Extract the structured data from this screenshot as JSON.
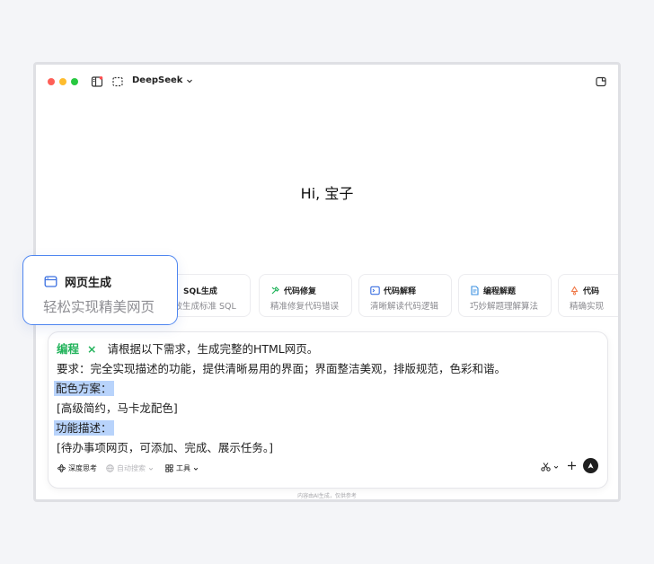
{
  "titlebar": {
    "app_name": "DeepSeek"
  },
  "greeting": "Hi, 宝子",
  "cards": [
    {
      "title": "SQL生成",
      "subtitle": "高效生成标准 SQL"
    },
    {
      "title": "代码修复",
      "subtitle": "精准修复代码错误"
    },
    {
      "title": "代码解释",
      "subtitle": "清晰解读代码逻辑"
    },
    {
      "title": "编程解题",
      "subtitle": "巧妙解题理解算法"
    },
    {
      "title": "代码",
      "subtitle": "精确实现"
    }
  ],
  "callout": {
    "title": "网页生成",
    "subtitle": "轻松实现精美网页"
  },
  "prompt": {
    "tag": "编程",
    "tag_close": "×",
    "line1": "请根据以下需求，生成完整的HTML网页。",
    "line2": "要求：完全实现描述的功能，提供清晰易用的界面；界面整洁美观，排版规范，色彩和谐。",
    "line3": "配色方案：",
    "line4": "[高级简约，马卡龙配色]",
    "line5": "功能描述：",
    "line6": "[待办事项网页，可添加、完成、展示任务。]"
  },
  "toolbar": {
    "deep_think": "深度思考",
    "web_search": "自动搜索",
    "tools": "工具"
  },
  "disclaimer": "内容由AI生成，仅供参考",
  "colors": {
    "accent": "#4f86f0",
    "tag_green": "#22b35b",
    "highlight": "#b8d3fb"
  }
}
